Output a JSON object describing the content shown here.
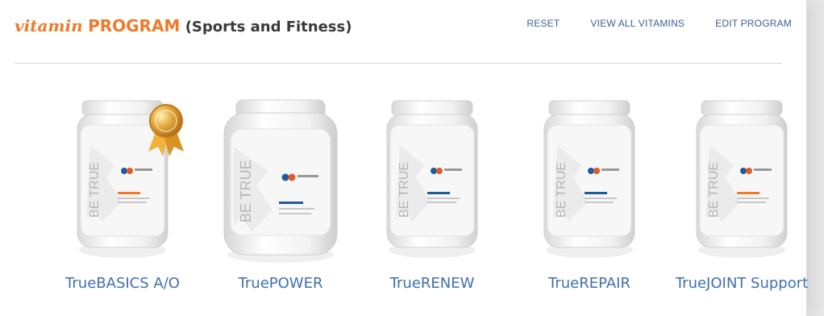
{
  "header": {
    "title_vitamin": "vitamin",
    "title_program": "PROGRAM",
    "title_sub": "(Sports and Fitness)",
    "actions": {
      "reset": "RESET",
      "view_all": "VIEW ALL VITAMINS",
      "edit": "EDIT PROGRAM"
    }
  },
  "products": [
    {
      "name": "TrueBASICS A/O",
      "label_text": "BE TRUE",
      "has_seal": true
    },
    {
      "name": "TruePOWER",
      "label_text": "BE TRUE",
      "has_seal": false
    },
    {
      "name": "TrueRENEW",
      "label_text": "BE TRUE",
      "has_seal": false
    },
    {
      "name": "TrueREPAIR",
      "label_text": "BE TRUE",
      "has_seal": false
    },
    {
      "name": "TrueJOINT Support",
      "label_text": "BE TRUE",
      "has_seal": false
    }
  ],
  "colors": {
    "accent_orange": "#f07a2b",
    "link_blue": "#3f6fb0",
    "action_blue": "#3b5e96"
  }
}
